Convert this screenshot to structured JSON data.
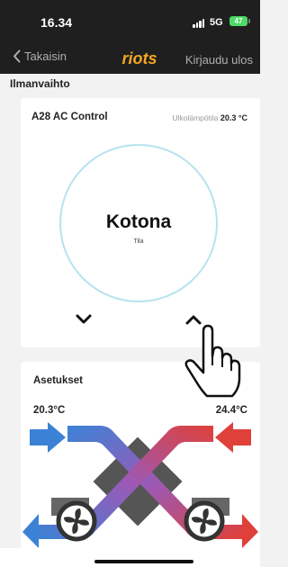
{
  "status_bar": {
    "time": "16.34",
    "network": "5G",
    "battery": "47"
  },
  "nav": {
    "back_label": "Takaisin",
    "logo_text": "riots",
    "logout_label": "Kirjaudu ulos"
  },
  "section": {
    "title": "Ilmanvaihto"
  },
  "control_card": {
    "title": "A28 AC Control",
    "outdoor_label": "Ulkolämpötila",
    "outdoor_value": "20.3 °C",
    "mode": "Kotona",
    "mode_sub": "Tila"
  },
  "settings_card": {
    "title": "Asetukset",
    "temp_left": "20.3°C",
    "temp_right": "24.4°C"
  },
  "colors": {
    "header_bg": "#1f1f1f",
    "logo": "#f5a623",
    "ring": "#b7e3ee",
    "cold": "#3b82d6",
    "hot": "#e0403a",
    "battery": "#4cd964"
  }
}
